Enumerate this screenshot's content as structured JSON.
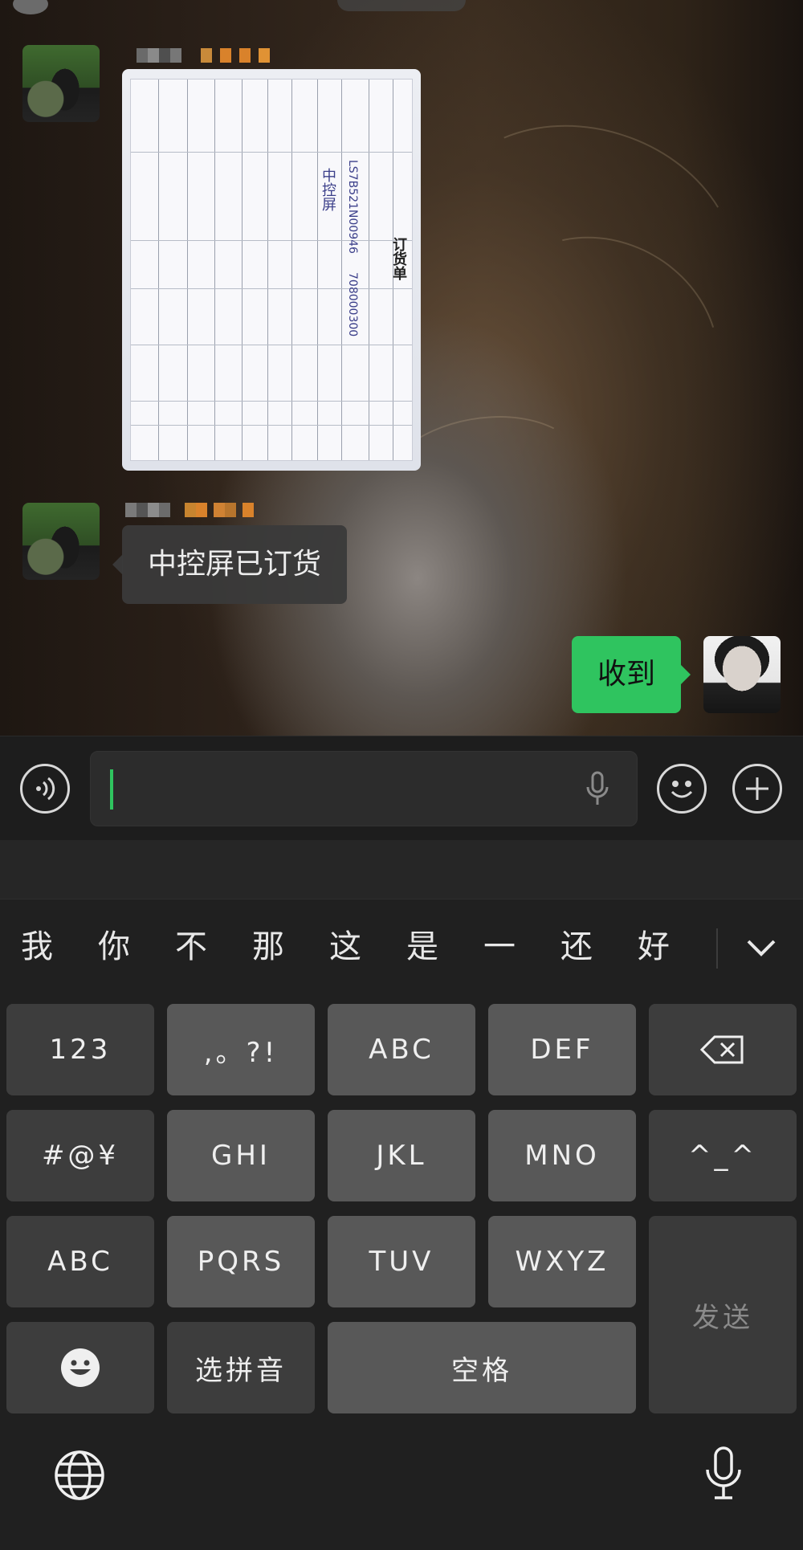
{
  "chat": {
    "messages": [
      {
        "sender": "other",
        "type": "image",
        "content": "order-form-photo",
        "sheet": {
          "title": "订货单",
          "handwriting_1": "中控屏",
          "handwriting_2": "LS7B521N00946",
          "handwriting_3": "708000300"
        }
      },
      {
        "sender": "other",
        "type": "text",
        "text": "中控屏已订货"
      },
      {
        "sender": "me",
        "type": "text",
        "text": "收到"
      }
    ]
  },
  "input_bar": {
    "voice_icon": "voice-toggle-icon",
    "mic_icon": "microphone-icon",
    "emoji_icon": "emoji-icon",
    "plus_icon": "plus-icon",
    "value": ""
  },
  "keyboard": {
    "candidates": [
      "我",
      "你",
      "不",
      "那",
      "这",
      "是",
      "一",
      "还",
      "好"
    ],
    "keys": {
      "num": "123",
      "punct": ",。?!",
      "abc": "ABC",
      "def": "DEF",
      "symbols": "#@¥",
      "ghi": "GHI",
      "jkl": "JKL",
      "mno": "MNO",
      "emoticon": "^_^",
      "abc_switch": "ABC",
      "pqrs": "PQRS",
      "tuv": "TUV",
      "wxyz": "WXYZ",
      "send": "发送",
      "pinyin": "选拼音",
      "space": "空格"
    },
    "colors": {
      "accent": "#2fc45f",
      "key": "#585858",
      "key_dark": "#3d3d3d"
    }
  }
}
